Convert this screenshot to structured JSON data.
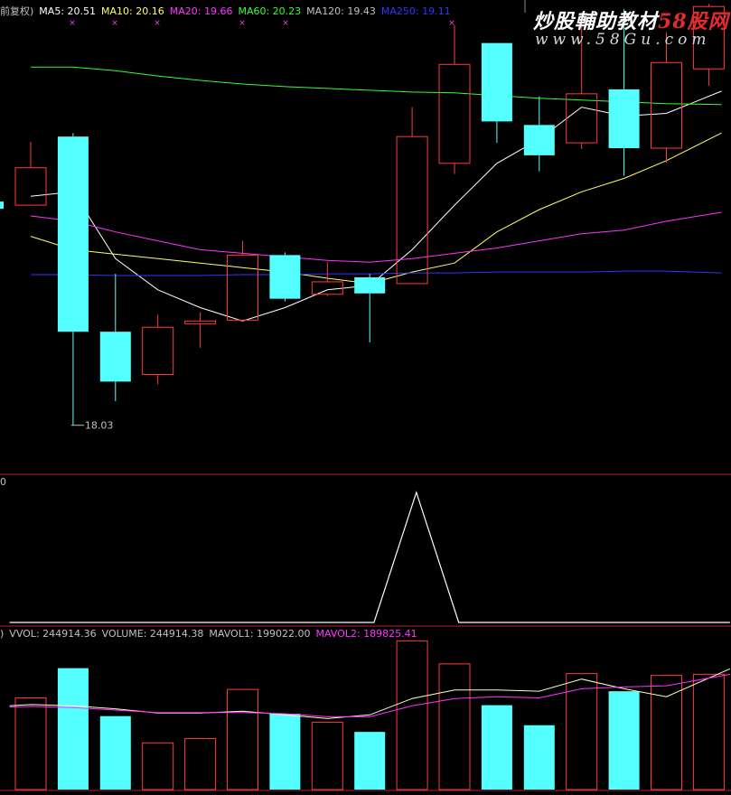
{
  "header": {
    "main_prefix": "前复权)",
    "ma": [
      {
        "label": "MA5: 20.51",
        "color": "#ffffff"
      },
      {
        "label": "MA10: 20.16",
        "color": "#ffff66"
      },
      {
        "label": "MA20: 19.66",
        "color": "#ff33ff"
      },
      {
        "label": "MA60: 20.23",
        "color": "#33ff33"
      },
      {
        "label": "MA120: 19.43",
        "color": "#c0c0c0"
      },
      {
        "label": "MA250: 19.11",
        "color": "#3333ff"
      }
    ],
    "mid_prefix": "0",
    "vol_prefix": ")",
    "vol": [
      {
        "label": "VVOL: 244914.36",
        "color": "#c0c0c0"
      },
      {
        "label": "VOLUME: 244914.38",
        "color": "#c0c0c0"
      },
      {
        "label": "MAVOL1: 199022.00",
        "color": "#c0c0c0"
      },
      {
        "label": "MAVOL2: 189825.41",
        "color": "#ff33ff"
      }
    ]
  },
  "watermark": {
    "line1_main": "炒股輔助教材",
    "line1_red": "58股网",
    "line2": "www.58Gu.com"
  },
  "colors": {
    "up": "#ff3b3b",
    "down": "#54ffff",
    "ma5": "#ffffff",
    "ma10": "#ffff66",
    "ma20": "#ff33ff",
    "ma60": "#33ff33",
    "ma250": "#3333ff",
    "divider": "#b0203a"
  },
  "chart_data": [
    {
      "type": "candlestick",
      "panel": "price",
      "ylim": [
        17.5,
        22.6
      ],
      "low_annotation": {
        "label": "18.03",
        "index": 1,
        "value": 18.03
      },
      "candles": [
        {
          "open": 20.5,
          "close": 20.92,
          "high": 21.21,
          "low": 20.5,
          "dir": "up"
        },
        {
          "open": 21.27,
          "close": 19.08,
          "high": 21.31,
          "low": 18.03,
          "dir": "down"
        },
        {
          "open": 19.08,
          "close": 18.52,
          "high": 19.73,
          "low": 18.3,
          "dir": "down"
        },
        {
          "open": 18.6,
          "close": 19.13,
          "high": 19.27,
          "low": 18.49,
          "dir": "up"
        },
        {
          "open": 19.17,
          "close": 19.2,
          "high": 19.3,
          "low": 18.9,
          "dir": "up"
        },
        {
          "open": 19.21,
          "close": 19.94,
          "high": 20.1,
          "low": 19.19,
          "dir": "up"
        },
        {
          "open": 19.94,
          "close": 19.45,
          "high": 19.97,
          "low": 19.42,
          "dir": "down"
        },
        {
          "open": 19.5,
          "close": 19.64,
          "high": 19.86,
          "low": 19.48,
          "dir": "up"
        },
        {
          "open": 19.69,
          "close": 19.51,
          "high": 19.73,
          "low": 18.96,
          "dir": "down"
        },
        {
          "open": 19.62,
          "close": 21.27,
          "high": 21.6,
          "low": 19.62,
          "dir": "up"
        },
        {
          "open": 20.97,
          "close": 22.08,
          "high": 22.52,
          "low": 20.85,
          "dir": "up"
        },
        {
          "open": 22.32,
          "close": 21.44,
          "high": 22.32,
          "low": 21.2,
          "dir": "down"
        },
        {
          "open": 21.4,
          "close": 21.06,
          "high": 21.72,
          "low": 20.88,
          "dir": "down"
        },
        {
          "open": 21.2,
          "close": 21.75,
          "high": 22.52,
          "low": 21.13,
          "dir": "up"
        },
        {
          "open": 21.8,
          "close": 21.14,
          "high": 22.7,
          "low": 20.83,
          "dir": "down"
        },
        {
          "open": 21.14,
          "close": 22.1,
          "high": 22.44,
          "low": 20.98,
          "dir": "up"
        },
        {
          "open": 22.03,
          "close": 22.73,
          "high": 22.76,
          "low": 21.84,
          "dir": "up"
        }
      ],
      "ma_series": [
        {
          "name": "MA5",
          "x": [
            0,
            1,
            2,
            3,
            4,
            5,
            6,
            7,
            8,
            9,
            10,
            11,
            12,
            13,
            14,
            15,
            16.3
          ],
          "values": [
            20.6,
            20.65,
            19.9,
            19.55,
            19.35,
            19.2,
            19.35,
            19.55,
            19.6,
            20.0,
            20.5,
            20.97,
            21.24,
            21.6,
            21.5,
            21.53,
            21.78
          ]
        },
        {
          "name": "MA10",
          "x": [
            0,
            1,
            2,
            3,
            4,
            5,
            6,
            7,
            8,
            9,
            10,
            11,
            12,
            13,
            14,
            15,
            16.3
          ],
          "values": [
            20.15,
            20.0,
            19.95,
            19.9,
            19.85,
            19.8,
            19.75,
            19.68,
            19.62,
            19.75,
            19.85,
            20.2,
            20.45,
            20.65,
            20.8,
            21.0,
            21.31
          ]
        },
        {
          "name": "MA20",
          "x": [
            0,
            1,
            2,
            3,
            4,
            5,
            6,
            7,
            8,
            9,
            10,
            11,
            12,
            13,
            14,
            15,
            16.3
          ],
          "values": [
            20.38,
            20.32,
            20.2,
            20.1,
            20.0,
            19.96,
            19.92,
            19.88,
            19.86,
            19.9,
            19.96,
            20.02,
            20.1,
            20.18,
            20.22,
            20.32,
            20.42
          ]
        },
        {
          "name": "MA60",
          "x": [
            0,
            1,
            2,
            3,
            4,
            5,
            6,
            7,
            8,
            9,
            10,
            11,
            12,
            13,
            14,
            15,
            16.3
          ],
          "values": [
            22.05,
            22.05,
            22.01,
            21.95,
            21.9,
            21.86,
            21.83,
            21.81,
            21.79,
            21.77,
            21.76,
            21.73,
            21.7,
            21.68,
            21.66,
            21.64,
            21.63
          ]
        },
        {
          "name": "MA250",
          "x": [
            0,
            1,
            2,
            3,
            4,
            5,
            6,
            7,
            8,
            9,
            10,
            11,
            12,
            13,
            14,
            15,
            16.3
          ],
          "values": [
            19.72,
            19.72,
            19.71,
            19.71,
            19.71,
            19.72,
            19.72,
            19.73,
            19.73,
            19.74,
            19.74,
            19.75,
            19.75,
            19.75,
            19.76,
            19.76,
            19.74
          ]
        }
      ]
    },
    {
      "type": "line",
      "panel": "indicator",
      "ylim": [
        0,
        1
      ],
      "x": [
        -0.5,
        8.1,
        9.1,
        10.1,
        16.5
      ],
      "values": [
        0,
        0,
        1,
        0,
        0
      ]
    },
    {
      "type": "bar",
      "panel": "volume",
      "ylim": [
        0,
        250000
      ],
      "bars": [
        {
          "value": 151000,
          "dir": "up"
        },
        {
          "value": 200000,
          "dir": "down"
        },
        {
          "value": 121000,
          "dir": "down"
        },
        {
          "value": 77000,
          "dir": "up"
        },
        {
          "value": 84000,
          "dir": "up"
        },
        {
          "value": 165000,
          "dir": "up"
        },
        {
          "value": 125000,
          "dir": "down"
        },
        {
          "value": 111000,
          "dir": "up"
        },
        {
          "value": 95000,
          "dir": "down"
        },
        {
          "value": 245000,
          "dir": "up"
        },
        {
          "value": 207000,
          "dir": "up"
        },
        {
          "value": 139000,
          "dir": "down"
        },
        {
          "value": 106000,
          "dir": "down"
        },
        {
          "value": 191000,
          "dir": "up"
        },
        {
          "value": 162000,
          "dir": "down"
        },
        {
          "value": 188000,
          "dir": "up"
        },
        {
          "value": 190000,
          "dir": "up"
        }
      ],
      "ma_series": [
        {
          "name": "MAVOL1",
          "x": [
            -0.5,
            0,
            1,
            2,
            3,
            4,
            5,
            6,
            7,
            8,
            9,
            10,
            11,
            12,
            13,
            14,
            15,
            16.5
          ],
          "values": [
            138000,
            140000,
            138000,
            133000,
            126000,
            126000,
            129000,
            123000,
            117000,
            123000,
            150000,
            164000,
            164000,
            162000,
            182000,
            166000,
            153000,
            199022
          ]
        },
        {
          "name": "MAVOL2",
          "x": [
            -0.5,
            0,
            1,
            2,
            3,
            4,
            5,
            6,
            7,
            8,
            9,
            10,
            11,
            12,
            13,
            14,
            15,
            16.5
          ],
          "values": [
            136000,
            137000,
            135000,
            131000,
            127000,
            127000,
            127000,
            125000,
            120000,
            120000,
            138000,
            150000,
            153000,
            151000,
            166000,
            169000,
            171000,
            189825
          ]
        }
      ]
    }
  ]
}
